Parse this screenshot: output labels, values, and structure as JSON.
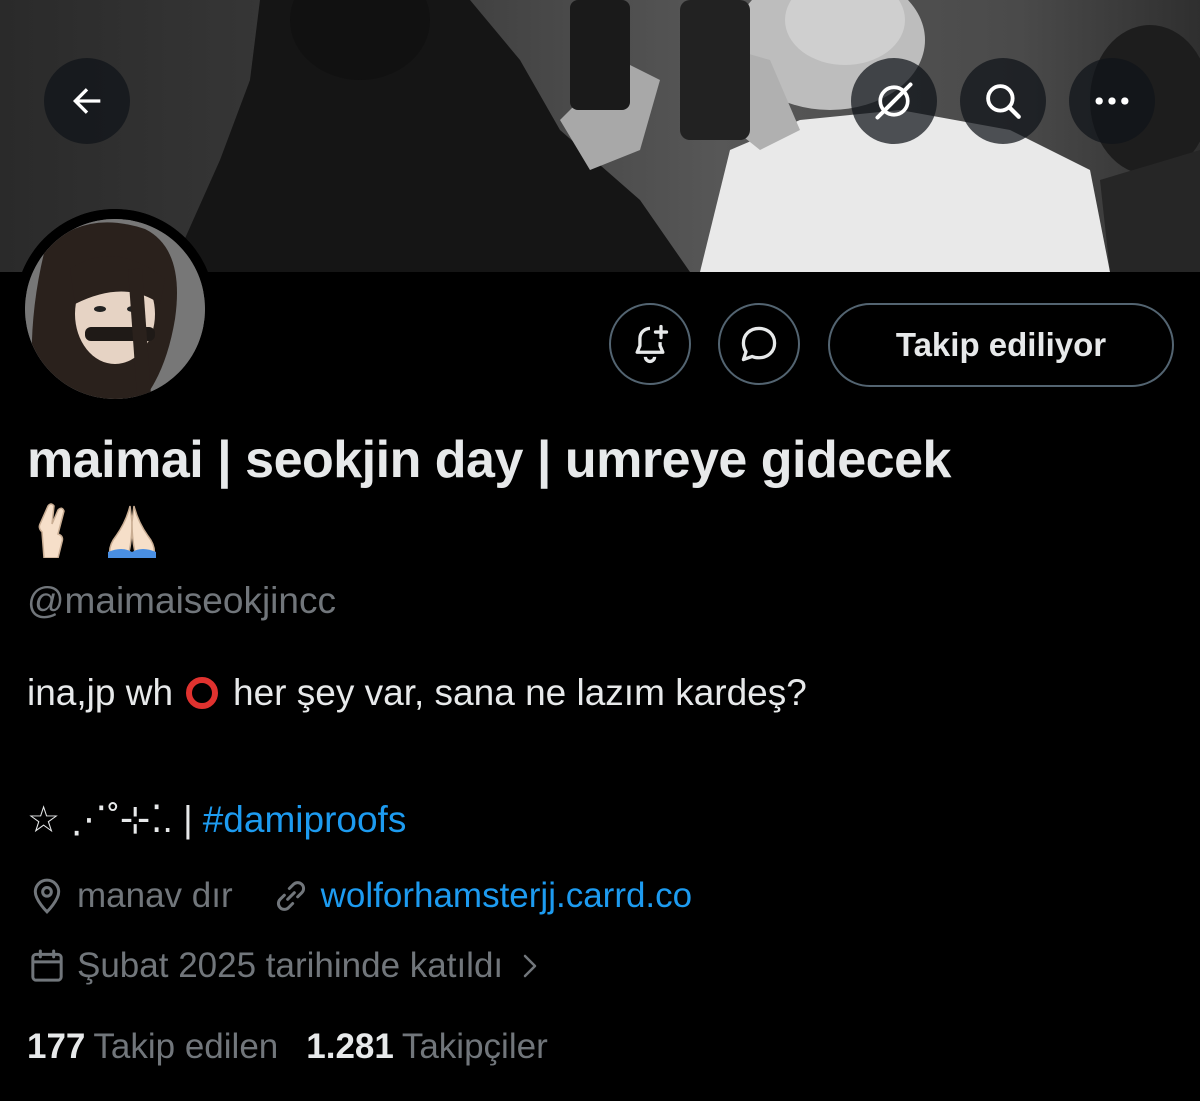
{
  "banner": {
    "back_icon": "arrow-left-icon",
    "grok_icon": "grok-icon",
    "search_icon": "search-icon",
    "more_icon": "more-horizontal-icon"
  },
  "actions": {
    "notify_icon": "bell-plus-icon",
    "message_icon": "message-bubble-icon",
    "follow_label": "Takip ediliyor"
  },
  "profile": {
    "display_name": "maimai | seokjin day | umreye gidecek",
    "name_emoji": [
      "🤞🏻",
      "🙏🏻"
    ],
    "handle": "@maimaiseokjincc",
    "bio_part1": "ina,jp wh",
    "bio_emoji": "⭕",
    "bio_part2": "her şey var, sana ne lazım kardeş?",
    "bio_line2_prefix": "☆ ⋰˚⊹⁚. |",
    "hashtag": "#damiproofs",
    "location": "manav dır",
    "website": "wolforhamsterjj.carrd.co",
    "joined": "Şubat 2025 tarihinde katıldı"
  },
  "stats": {
    "following_count": "177",
    "following_label": "Takip edilen",
    "followers_count": "1.281",
    "followers_label": "Takipçiler"
  },
  "colors": {
    "background": "#000000",
    "text": "#e7e9ea",
    "muted": "#71767b",
    "link": "#1d9bf0",
    "border": "#536471"
  }
}
